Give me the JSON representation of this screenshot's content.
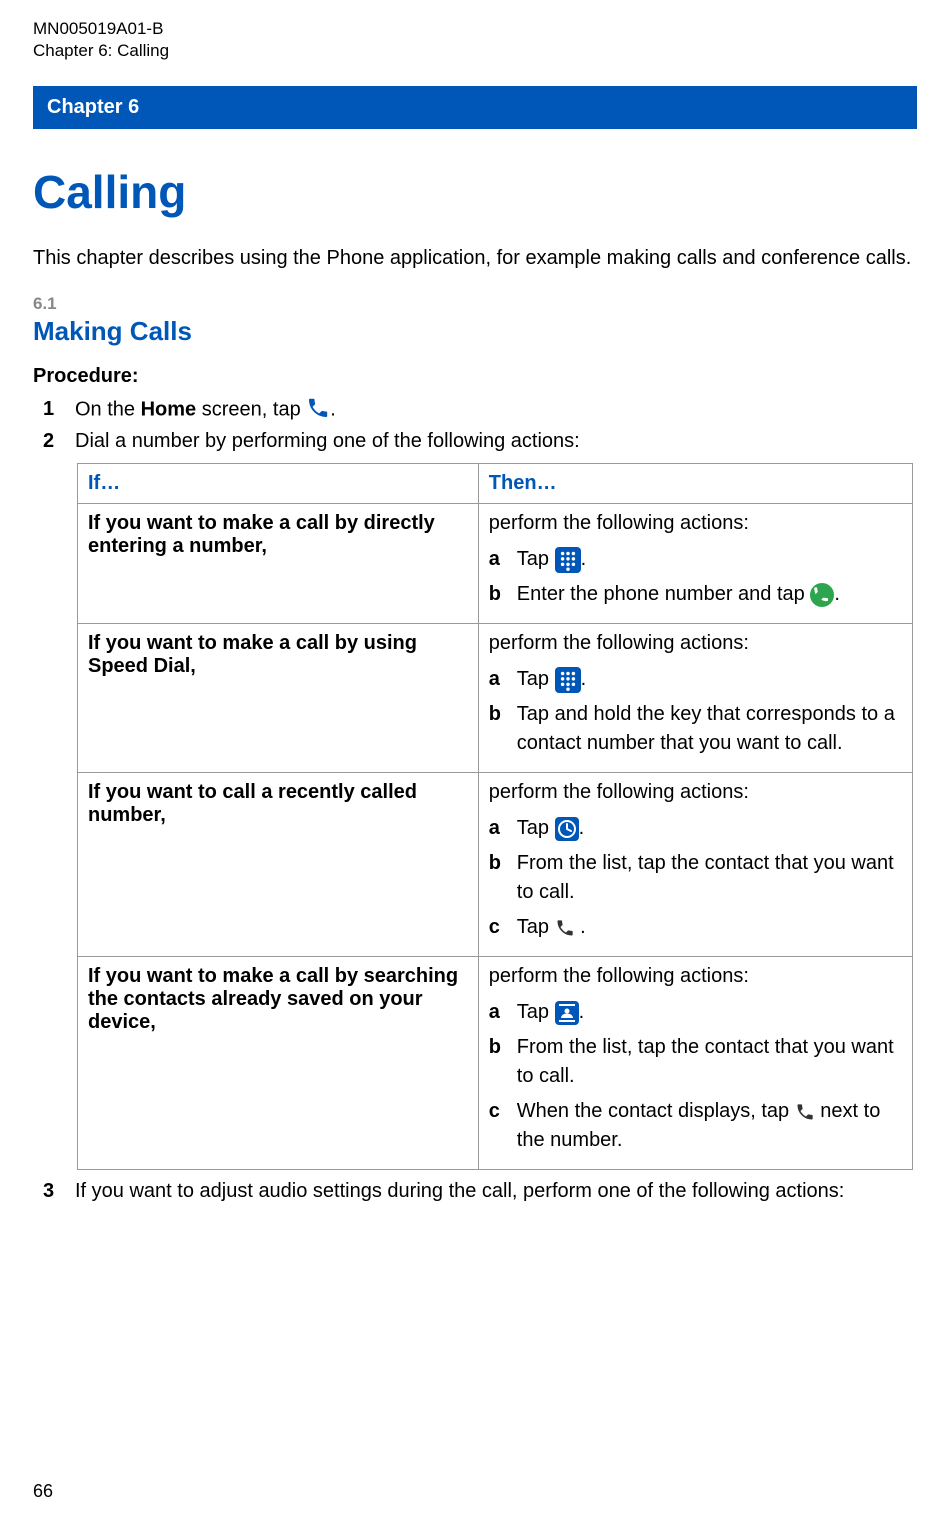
{
  "header": {
    "doc_id": "MN005019A01-B",
    "chapter_line": "Chapter 6:  Calling"
  },
  "chapter_bar": "Chapter 6",
  "title": "Calling",
  "intro": "This chapter describes using the Phone application, for example making calls and conference calls.",
  "section": {
    "number": "6.1",
    "title": "Making Calls"
  },
  "procedure_label": "Procedure:",
  "steps": {
    "s1": {
      "num": "1",
      "pre": "On the ",
      "bold": "Home",
      "post": " screen, tap ",
      "suffix": "."
    },
    "s2": {
      "num": "2",
      "text": "Dial a number by performing one of the following actions:"
    },
    "s3": {
      "num": "3",
      "text": "If you want to adjust audio settings during the call, perform one of the following actions:"
    }
  },
  "table": {
    "headers": {
      "if": "If…",
      "then": "Then…"
    },
    "rows": [
      {
        "if": "If you want to make a call by directly entering a number,",
        "then_intro": "perform the following actions:",
        "subs": [
          {
            "let": "a",
            "pre": "Tap ",
            "icon": "dialpad-icon",
            "post": "."
          },
          {
            "let": "b",
            "pre": "Enter the phone number and tap ",
            "icon": "call-green-icon",
            "post": "."
          }
        ]
      },
      {
        "if": "If you want to make a call by using Speed Dial,",
        "then_intro": "perform the following actions:",
        "subs": [
          {
            "let": "a",
            "pre": "Tap ",
            "icon": "dialpad-icon",
            "post": "."
          },
          {
            "let": "b",
            "pre": "Tap and hold the key that corresponds to a contact number that you want to call.",
            "icon": "",
            "post": ""
          }
        ]
      },
      {
        "if": "If you want to call a recently called number,",
        "then_intro": "perform the following actions:",
        "subs": [
          {
            "let": "a",
            "pre": "Tap ",
            "icon": "recents-clock-icon",
            "post": "."
          },
          {
            "let": "b",
            "pre": "From the list, tap the contact that you want to call.",
            "icon": "",
            "post": ""
          },
          {
            "let": "c",
            "pre": "Tap  ",
            "icon": "phone-handset-dark-icon",
            "post": " ."
          }
        ]
      },
      {
        "if": "If you want to make a call by searching the contacts already saved on your device,",
        "then_intro": "perform the following actions:",
        "subs": [
          {
            "let": "a",
            "pre": "Tap ",
            "icon": "contacts-icon",
            "post": "."
          },
          {
            "let": "b",
            "pre": "From the list, tap the contact that you want to call.",
            "icon": "",
            "post": ""
          },
          {
            "let": "c",
            "pre": "When the contact displays, tap ",
            "icon": "phone-handset-dark-icon",
            "post": " next to the number."
          }
        ]
      }
    ]
  },
  "page_number": "66"
}
